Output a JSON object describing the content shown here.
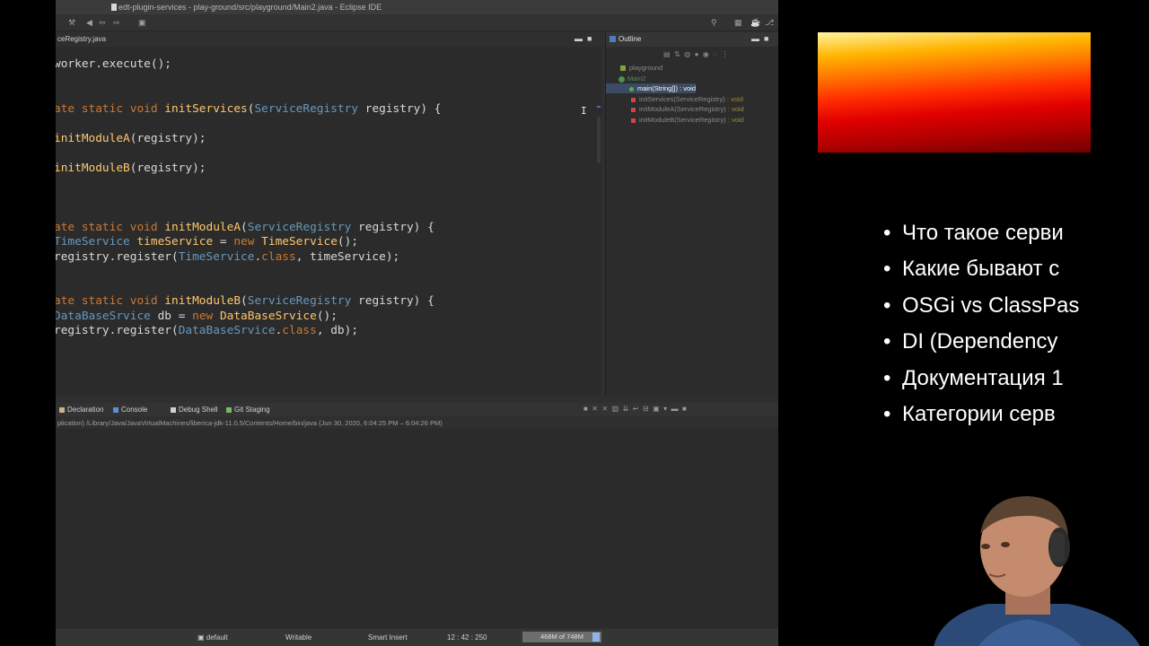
{
  "window": {
    "title": "edt-plugin-services - play-ground/src/playground/Main2.java - Eclipse IDE"
  },
  "editor": {
    "tab_label": "ceRegistry.java",
    "lines": [
      {
        "parts": [
          {
            "t": "worker.execute();",
            "c": "txt"
          }
        ]
      },
      {
        "parts": [
          {
            "t": "ate static void ",
            "c": "kw"
          },
          {
            "t": "initServices",
            "c": "mt"
          },
          {
            "t": "(",
            "c": "txt"
          },
          {
            "t": "ServiceRegistry",
            "c": "ty"
          },
          {
            "t": " registry) {",
            "c": "txt"
          }
        ]
      },
      {
        "parts": [
          {
            "t": "initModuleA",
            "c": "mt"
          },
          {
            "t": "(registry);",
            "c": "txt"
          }
        ]
      },
      {
        "parts": [
          {
            "t": "initModuleB",
            "c": "mt"
          },
          {
            "t": "(registry);",
            "c": "txt"
          }
        ]
      },
      {
        "parts": [
          {
            "t": "ate static void ",
            "c": "kw"
          },
          {
            "t": "initModuleA",
            "c": "mt"
          },
          {
            "t": "(",
            "c": "txt"
          },
          {
            "t": "ServiceRegistry",
            "c": "ty"
          },
          {
            "t": " registry) {",
            "c": "txt"
          }
        ]
      },
      {
        "parts": [
          {
            "t": "TimeService",
            "c": "ty"
          },
          {
            "t": " timeService",
            "c": "mt"
          },
          {
            "t": " = ",
            "c": "txt"
          },
          {
            "t": "new ",
            "c": "kw"
          },
          {
            "t": "TimeService",
            "c": "mt"
          },
          {
            "t": "();",
            "c": "txt"
          }
        ]
      },
      {
        "parts": [
          {
            "t": "registry.register(",
            "c": "txt"
          },
          {
            "t": "TimeService",
            "c": "ty"
          },
          {
            "t": ".",
            "c": "txt"
          },
          {
            "t": "class",
            "c": "kw"
          },
          {
            "t": ", timeService);",
            "c": "txt"
          }
        ]
      },
      {
        "parts": [
          {
            "t": "ate static void ",
            "c": "kw"
          },
          {
            "t": "initModuleB",
            "c": "mt"
          },
          {
            "t": "(",
            "c": "txt"
          },
          {
            "t": "ServiceRegistry",
            "c": "ty"
          },
          {
            "t": " registry) {",
            "c": "txt"
          }
        ]
      },
      {
        "parts": [
          {
            "t": "DataBaseSrvice",
            "c": "ty"
          },
          {
            "t": " db = ",
            "c": "txt"
          },
          {
            "t": "new ",
            "c": "kw"
          },
          {
            "t": "DataBaseSrvice",
            "c": "mt"
          },
          {
            "t": "();",
            "c": "txt"
          }
        ]
      },
      {
        "parts": [
          {
            "t": "registry.register(",
            "c": "txt"
          },
          {
            "t": "DataBaseSrvice",
            "c": "ty"
          },
          {
            "t": ".",
            "c": "txt"
          },
          {
            "t": "class",
            "c": "kw"
          },
          {
            "t": ", db);",
            "c": "txt"
          }
        ]
      }
    ]
  },
  "outline": {
    "tab_label": "Outline",
    "items": [
      {
        "label": "playground",
        "sig": "",
        "rtype": "",
        "kind": "package"
      },
      {
        "label": "Main2",
        "sig": "",
        "rtype": "",
        "kind": "class"
      },
      {
        "label": "main(String[]) : void",
        "sig": "",
        "rtype": "",
        "kind": "public",
        "selected": true
      },
      {
        "label": "initServices(ServiceRegistry)",
        "sig": "",
        "rtype": " : void",
        "kind": "private"
      },
      {
        "label": "initModuleA(ServiceRegistry)",
        "sig": "",
        "rtype": " : void",
        "kind": "private"
      },
      {
        "label": "initModuleB(ServiceRegistry)",
        "sig": "",
        "rtype": " : void",
        "kind": "private"
      }
    ]
  },
  "console": {
    "tabs": [
      {
        "label": "Declaration",
        "color": "#c9b18a"
      },
      {
        "label": "Console",
        "color": "#5d8fd6"
      },
      {
        "label": "Debug Shell",
        "color": "#d0d0d0"
      },
      {
        "label": "Git Staging",
        "color": "#7ab86a"
      }
    ],
    "path": "plication) /Library/Java/JavaVirtualMachines/liberica-jdk-11.0.5/Contents/Home/bin/java  (Jun 30, 2020, 6:04:25 PM – 6:04:26 PM)"
  },
  "statusbar": {
    "perspective": "default",
    "writable": "Writable",
    "insert_mode": "Smart Insert",
    "position": "12 : 42 : 250",
    "heap": "468M of 748M"
  },
  "slide": {
    "bullets": [
      "Что такое серви",
      "Какие бывают с",
      "OSGi vs ClassPas",
      "DI (Dependency",
      "Документация 1",
      "Категории серв"
    ]
  }
}
